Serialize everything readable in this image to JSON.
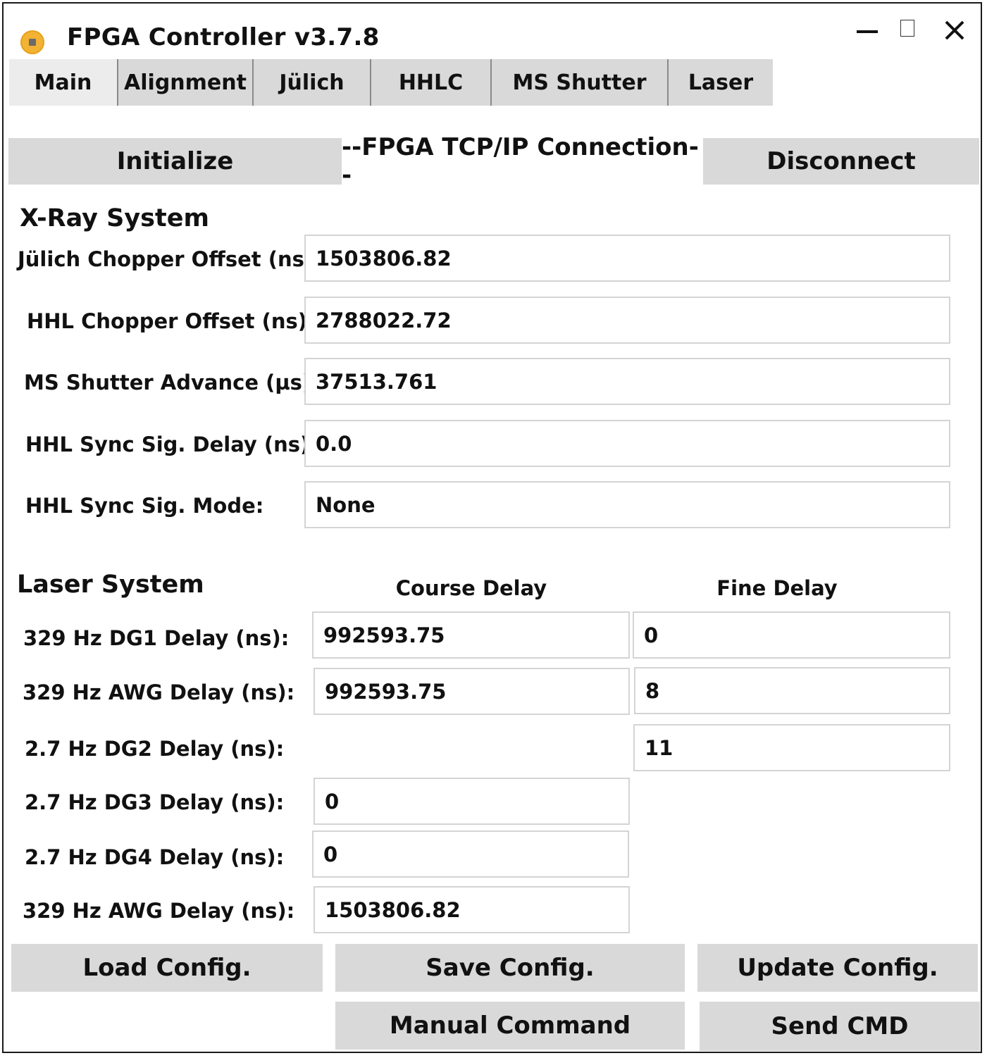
{
  "window": {
    "title": "FPGA Controller v3.7.8",
    "icon": "app-icon"
  },
  "tabs": [
    {
      "label": "Main",
      "active": true
    },
    {
      "label": "Alignment"
    },
    {
      "label": "Jülich"
    },
    {
      "label": "HHLC"
    },
    {
      "label": "MS Shutter"
    },
    {
      "label": "Laser"
    }
  ],
  "connection": {
    "initialize_label": "Initialize",
    "status_label": "--FPGA TCP/IP Connection--",
    "disconnect_label": "Disconnect"
  },
  "xray": {
    "heading": "X-Ray System",
    "fields": [
      {
        "label": "Jülich Chopper Offset (ns):",
        "value": "1503806.82"
      },
      {
        "label": "HHL Chopper Offset (ns):",
        "value": "2788022.72"
      },
      {
        "label": "MS Shutter Advance (µs):",
        "value": "37513.761"
      },
      {
        "label": "HHL Sync Sig. Delay (ns):",
        "value": "0.0"
      },
      {
        "label": "HHL Sync Sig. Mode:",
        "value": "None"
      }
    ]
  },
  "laser": {
    "heading": "Laser System",
    "course_header": "Course Delay",
    "fine_header": "Fine Delay",
    "rows": [
      {
        "label": "329 Hz DG1 Delay (ns):",
        "course": "992593.75",
        "fine": "0"
      },
      {
        "label": "329 Hz AWG Delay (ns):",
        "course": "992593.75",
        "fine": "8"
      },
      {
        "label": "2.7 Hz DG2 Delay (ns):",
        "fine": "11"
      },
      {
        "label": "2.7 Hz DG3 Delay (ns):",
        "course": "0"
      },
      {
        "label": "2.7 Hz DG4 Delay (ns):",
        "course": "0"
      },
      {
        "label": "329 Hz AWG Delay (ns):",
        "course": "1503806.82"
      }
    ]
  },
  "actions": {
    "load_label": "Load Config.",
    "save_label": "Save Config.",
    "update_label": "Update Config.",
    "manual_label": "Manual Command",
    "send_label": "Send CMD"
  }
}
